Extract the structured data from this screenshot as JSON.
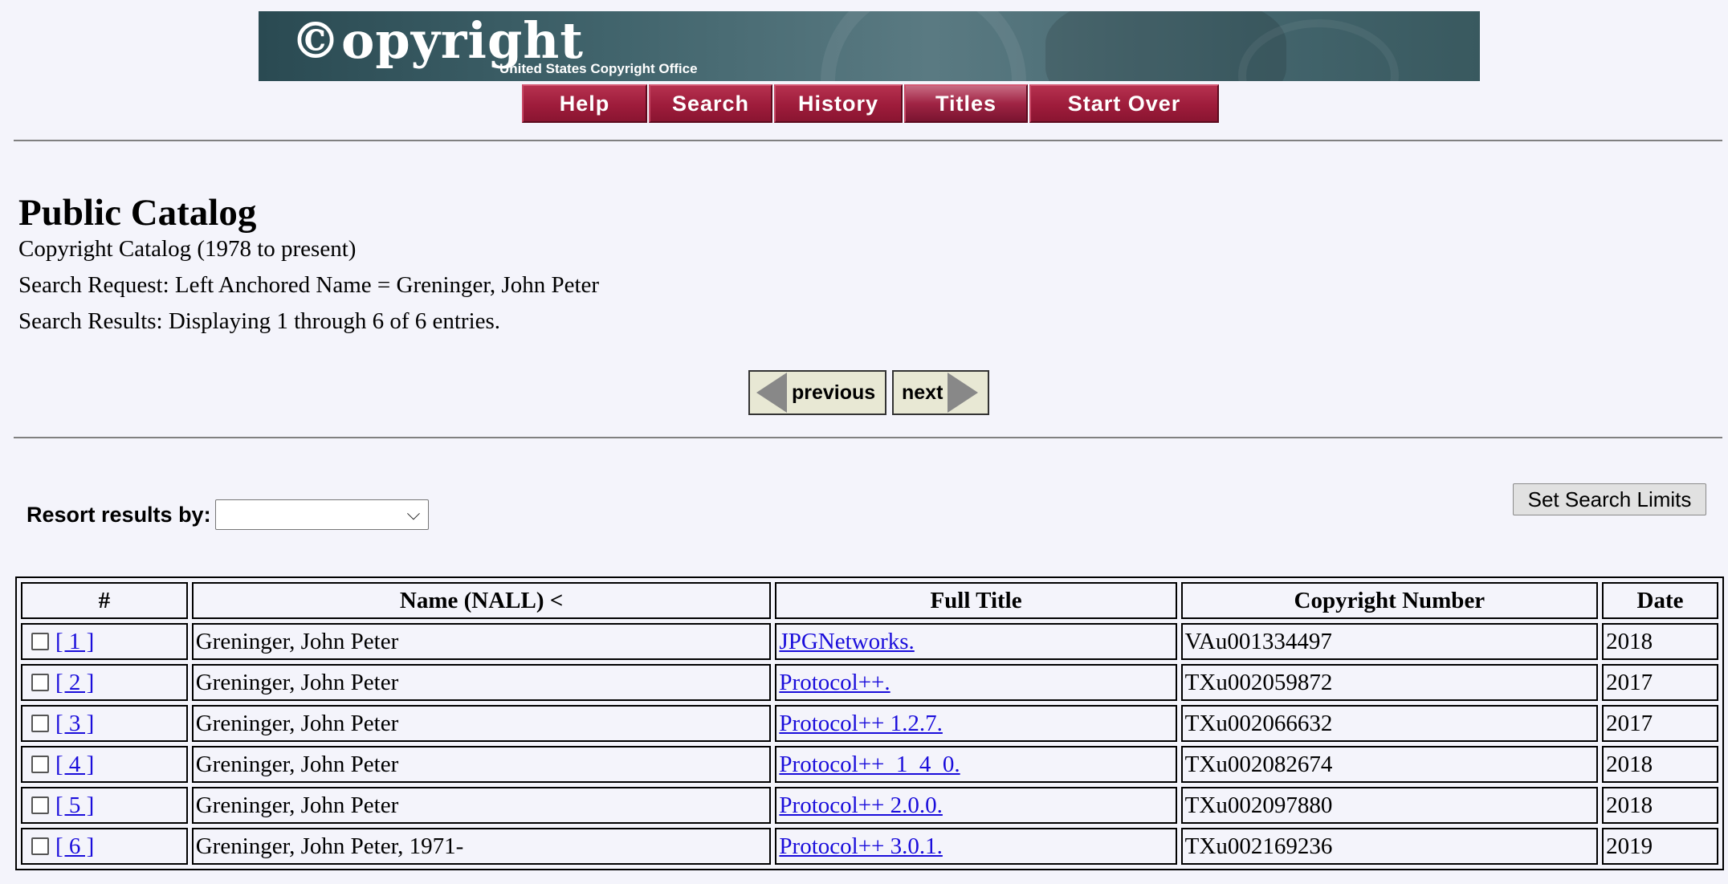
{
  "banner": {
    "logo_text": "©opyright",
    "subtitle": "United States Copyright Office"
  },
  "nav": {
    "items": [
      {
        "label": "Help"
      },
      {
        "label": "Search"
      },
      {
        "label": "History"
      },
      {
        "label": "Titles",
        "active": true
      },
      {
        "label": "Start Over"
      }
    ]
  },
  "header": {
    "title": "Public Catalog",
    "catalog": "Copyright Catalog (1978 to present)",
    "search_request": "Search Request: Left Anchored Name = Greninger, John Peter",
    "search_results": "Search Results: Displaying 1 through 6 of 6 entries."
  },
  "pager": {
    "previous_label": "previous",
    "next_label": "next"
  },
  "controls": {
    "resort_label": "Resort results by:",
    "resort_value": "",
    "set_limits_label": "Set Search Limits"
  },
  "table": {
    "columns": [
      "#",
      "Name (NALL) <",
      "Full Title",
      "Copyright Number",
      "Date"
    ],
    "rows": [
      {
        "num": "[ 1 ]",
        "name": "Greninger, John Peter",
        "title": "JPGNetworks.",
        "copyright_number": "VAu001334497",
        "date": "2018"
      },
      {
        "num": "[ 2 ]",
        "name": "Greninger, John Peter",
        "title": "Protocol++.",
        "copyright_number": "TXu002059872",
        "date": "2017"
      },
      {
        "num": "[ 3 ]",
        "name": "Greninger, John Peter",
        "title": "Protocol++ 1.2.7.",
        "copyright_number": "TXu002066632",
        "date": "2017"
      },
      {
        "num": "[ 4 ]",
        "name": "Greninger, John Peter",
        "title": "Protocol++_1_4_0.",
        "copyright_number": "TXu002082674",
        "date": "2018"
      },
      {
        "num": "[ 5 ]",
        "name": "Greninger, John Peter",
        "title": "Protocol++ 2.0.0.",
        "copyright_number": "TXu002097880",
        "date": "2018"
      },
      {
        "num": "[ 6 ]",
        "name": "Greninger, John Peter, 1971-",
        "title": "Protocol++ 3.0.1.",
        "copyright_number": "TXu002169236",
        "date": "2019"
      }
    ]
  }
}
